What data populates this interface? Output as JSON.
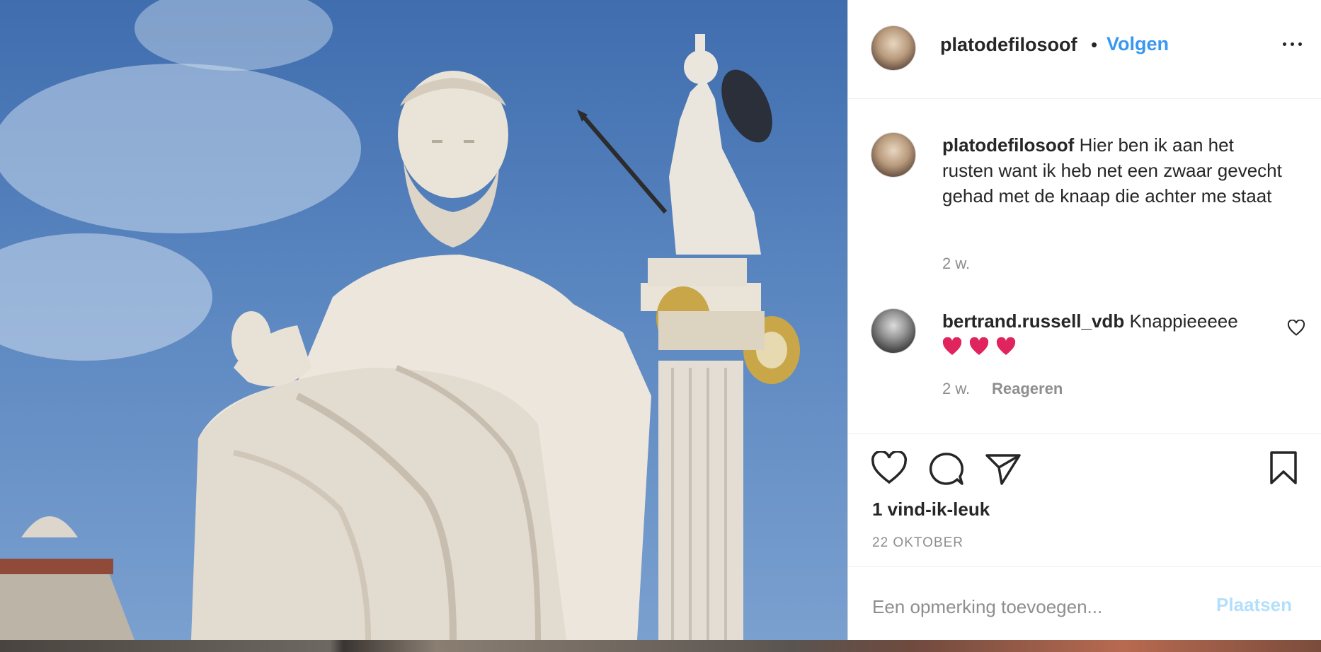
{
  "post": {
    "author": "platodefilosoof",
    "separator": "•",
    "follow_label": "Volgen",
    "more_label": "Meer opties",
    "caption": {
      "username": "platodefilosoof",
      "text": "Hier ben ik aan het rusten want ik heb net een zwaar gevecht gehad met de knaap die achter me staat",
      "time": "2 w."
    },
    "comments": [
      {
        "username": "bertrand.russell_vdb",
        "text": "Knappieeeee",
        "emoji": [
          "red-heart",
          "red-heart",
          "red-heart"
        ],
        "time": "2 w.",
        "reply_label": "Reageren"
      }
    ],
    "likes_text": "1 vind-ik-leuk",
    "date_text": "22 OKTOBER",
    "comment_box": {
      "placeholder": "Een opmerking toevoegen...",
      "submit_label": "Plaatsen"
    }
  },
  "colors": {
    "link": "#3897f0",
    "muted": "#8e8e8e",
    "submit_disabled": "#b2dffc",
    "text": "#262626",
    "heart": "#e0245e"
  },
  "icons": {
    "like": "heart-outline-icon",
    "comment": "speech-bubble-icon",
    "share": "paper-plane-icon",
    "save": "bookmark-icon",
    "more": "ellipsis-icon"
  }
}
